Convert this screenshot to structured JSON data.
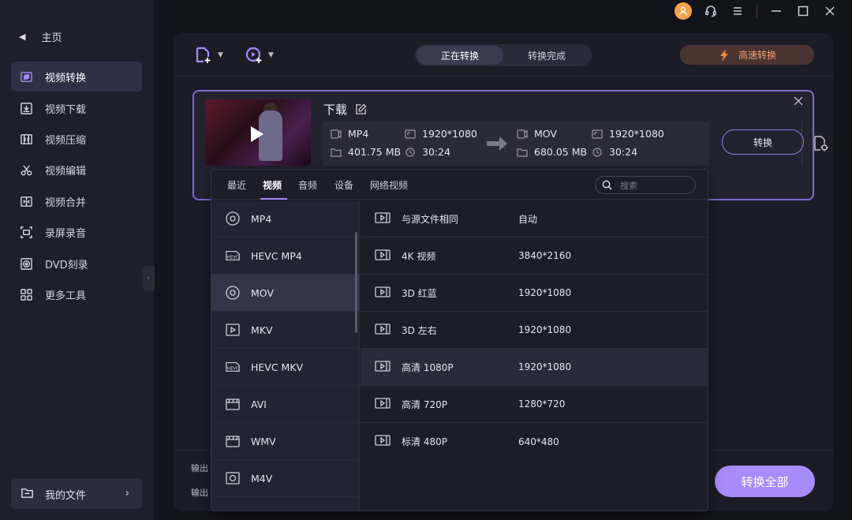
{
  "sidebar": {
    "home_label": "主页",
    "items": [
      {
        "label": "视频转换",
        "icon": "convert-icon",
        "active": true
      },
      {
        "label": "视频下载",
        "icon": "download-icon"
      },
      {
        "label": "视频压缩",
        "icon": "compress-icon"
      },
      {
        "label": "视频编辑",
        "icon": "scissors-icon"
      },
      {
        "label": "视频合并",
        "icon": "merge-icon"
      },
      {
        "label": "录屏录音",
        "icon": "record-icon"
      },
      {
        "label": "DVD刻录",
        "icon": "dvd-icon"
      },
      {
        "label": "更多工具",
        "icon": "grid-icon"
      }
    ],
    "files_label": "我的文件"
  },
  "toolbar": {
    "tabs": [
      "正在转换",
      "转换完成"
    ],
    "active_tab": "正在转换",
    "highspeed_label": "高速转换"
  },
  "file": {
    "title": "下载",
    "source": {
      "format": "MP4",
      "resolution": "1920*1080",
      "size": "401.75 MB",
      "duration": "30:24"
    },
    "target": {
      "format": "MOV",
      "resolution": "1920*1080",
      "size": "680.05 MB",
      "duration": "30:24"
    },
    "convert_label": "转换"
  },
  "bottom": {
    "output_label_1": "输出",
    "output_label_2": "输出",
    "convert_all_label": "转换全部"
  },
  "format_dropdown": {
    "tabs": [
      "最近",
      "视频",
      "音频",
      "设备",
      "网络视频"
    ],
    "active_tab": "视频",
    "search_placeholder": "搜索",
    "formats": [
      "MP4",
      "HEVC MP4",
      "MOV",
      "MKV",
      "HEVC MKV",
      "AVI",
      "WMV",
      "M4V"
    ],
    "selected_format": "MOV",
    "presets": [
      {
        "name": "与源文件相同",
        "res": "自动"
      },
      {
        "name": "4K 视频",
        "res": "3840*2160"
      },
      {
        "name": "3D 红蓝",
        "res": "1920*1080"
      },
      {
        "name": "3D 左右",
        "res": "1920*1080"
      },
      {
        "name": "高清 1080P",
        "res": "1920*1080"
      },
      {
        "name": "高清 720P",
        "res": "1280*720"
      },
      {
        "name": "标清 480P",
        "res": "640*480"
      }
    ],
    "selected_preset": "高清 1080P"
  },
  "colors": {
    "accent": "#a78bfa",
    "highspeed_text": "#f0a070",
    "avatar": "#f4a24b"
  }
}
